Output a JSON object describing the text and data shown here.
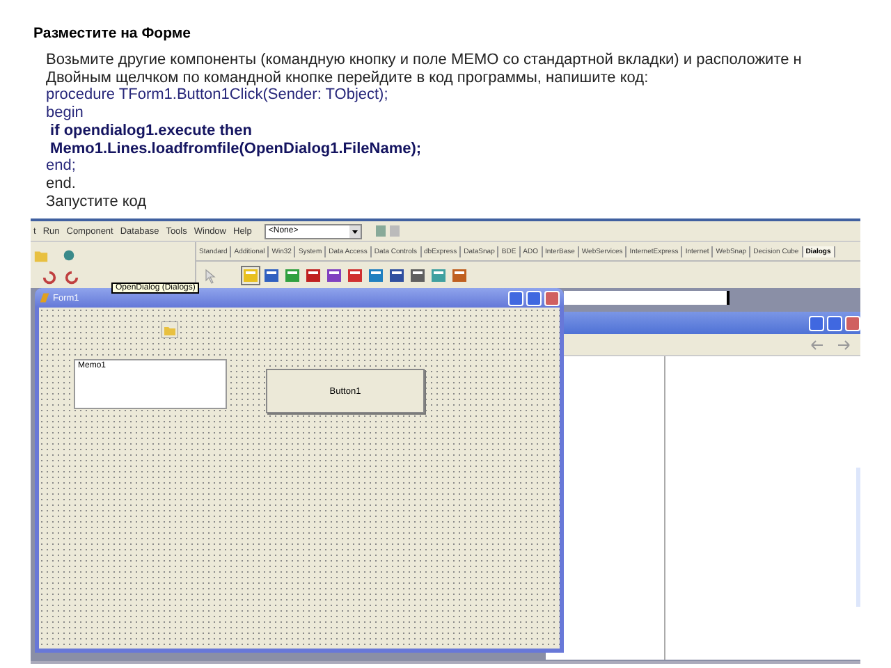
{
  "slide": {
    "heading": "Разместите на Форме",
    "lines": [
      {
        "kind": "text",
        "text": "Возьмите другие компоненты (командную кнопку и поле МЕМО со стандартной вкладки) и расположите н"
      },
      {
        "kind": "text",
        "text": "Двойным щелчком по командной кнопке перейдите в код программы, напишите код:"
      },
      {
        "kind": "code",
        "text": "procedure TForm1.Button1Click(Sender: TObject);"
      },
      {
        "kind": "code",
        "text": "begin"
      },
      {
        "kind": "bold",
        "text": " if opendialog1.execute then"
      },
      {
        "kind": "bold",
        "text": " Memo1.Lines.loadfromfile(OpenDialog1.FileName);"
      },
      {
        "kind": "code",
        "text": "end;"
      },
      {
        "kind": "text",
        "text": "end."
      },
      {
        "kind": "text",
        "text": "Запустите код"
      }
    ]
  },
  "ide": {
    "menu": [
      "t",
      "Run",
      "Component",
      "Database",
      "Tools",
      "Window",
      "Help"
    ],
    "combo": "<None>",
    "palette_tabs": [
      {
        "label": "Standard",
        "selected": false
      },
      {
        "label": "Additional",
        "selected": false
      },
      {
        "label": "Win32",
        "selected": false
      },
      {
        "label": "System",
        "selected": false
      },
      {
        "label": "Data Access",
        "selected": false
      },
      {
        "label": "Data Controls",
        "selected": false
      },
      {
        "label": "dbExpress",
        "selected": false
      },
      {
        "label": "DataSnap",
        "selected": false
      },
      {
        "label": "BDE",
        "selected": false
      },
      {
        "label": "ADO",
        "selected": false
      },
      {
        "label": "InterBase",
        "selected": false
      },
      {
        "label": "WebServices",
        "selected": false
      },
      {
        "label": "InternetExpress",
        "selected": false
      },
      {
        "label": "Internet",
        "selected": false
      },
      {
        "label": "WebSnap",
        "selected": false
      },
      {
        "label": "Decision Cube",
        "selected": false
      },
      {
        "label": "Dialogs",
        "selected": true
      }
    ],
    "tooltip": "OpenDialog (Dialogs)",
    "form": {
      "title": "Form1",
      "memo": "Memo1",
      "button": "Button1"
    }
  }
}
